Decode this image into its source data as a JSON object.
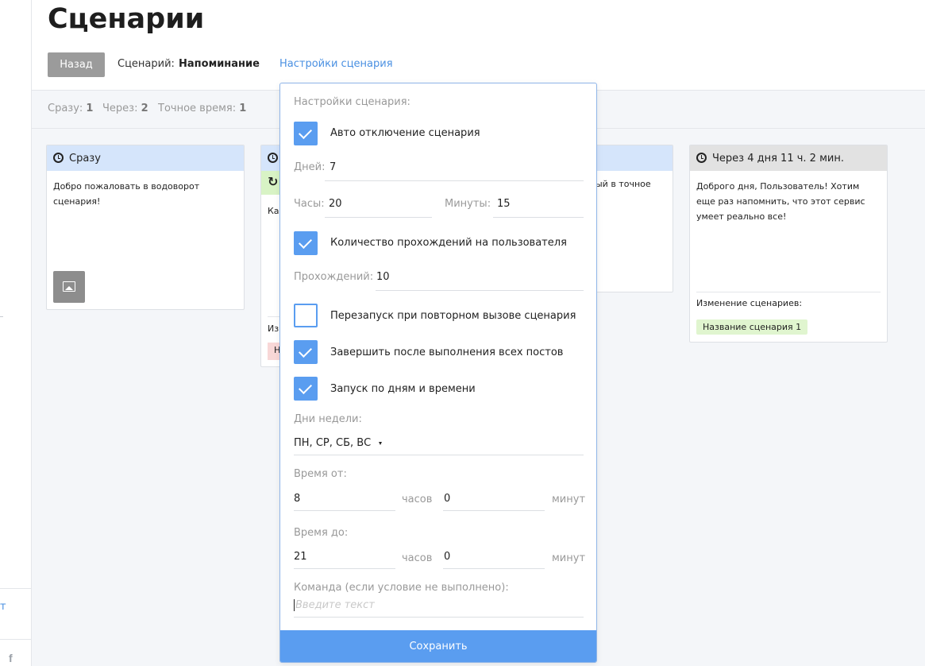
{
  "sidebar": {
    "link_text": "т",
    "social_icon": "f"
  },
  "header": {
    "title": "Сценарии",
    "back_label": "Назад",
    "scenario_label": "Сценарий:",
    "scenario_name": "Напоминание",
    "settings_link": "Настройки сценария"
  },
  "stats": [
    {
      "label": "Сразу:",
      "value": "1"
    },
    {
      "label": "Через:",
      "value": "2"
    },
    {
      "label": "Точное время:",
      "value": "1"
    }
  ],
  "cards": {
    "first": {
      "title": "Сразу",
      "text": "Добро пожаловать в водоворот сценария!"
    },
    "second": {
      "body_fragment": "Ка",
      "footer_fragment": "Из",
      "tag_fragment": "Н"
    },
    "third": {
      "text_fragment": "ый в точное"
    },
    "fourth": {
      "title": "Через 4 дня 11 ч. 2 мин.",
      "text": "Доброго дня, Пользователь! Хотим еще раз напомнить, что этот сервис умеет реально все!",
      "changes_label": "Изменение сценариев:",
      "tag": "Название сценария 1"
    }
  },
  "popup": {
    "heading": "Настройки сценария:",
    "auto_disable": {
      "label": "Авто отключение сценария",
      "checked": true
    },
    "days": {
      "label": "Дней:",
      "value": "7"
    },
    "hours": {
      "label": "Часы:",
      "value": "20"
    },
    "minutes": {
      "label": "Минуты:",
      "value": "15"
    },
    "pass_count": {
      "label": "Количество прохождений на пользователя",
      "checked": true
    },
    "passes": {
      "label": "Прохождений:",
      "value": "10"
    },
    "restart": {
      "label": "Перезапуск при повторном вызове сценария",
      "checked": false
    },
    "finish_after_posts": {
      "label": "Завершить после выполнения всех постов",
      "checked": true
    },
    "schedule": {
      "label": "Запуск по дням и времени",
      "checked": true
    },
    "weekdays": {
      "label": "Дни недели:",
      "value": "ПН, СР, СБ, ВС"
    },
    "time_from": {
      "label": "Время от:",
      "hours": "8",
      "hours_unit": "часов",
      "minutes": "0",
      "minutes_unit": "минут"
    },
    "time_to": {
      "label": "Время до:",
      "hours": "21",
      "hours_unit": "часов",
      "minutes": "0",
      "minutes_unit": "минут"
    },
    "command": {
      "label": "Команда (если условие не выполнено):",
      "placeholder": "Введите текст"
    },
    "save_label": "Сохранить"
  },
  "colors": {
    "accent": "#5a9df0",
    "link": "#4a90e2",
    "card_head_blue": "#d5e5fb",
    "card_head_gray": "#e2e2e2",
    "tag_green": "#e0f5cf"
  }
}
